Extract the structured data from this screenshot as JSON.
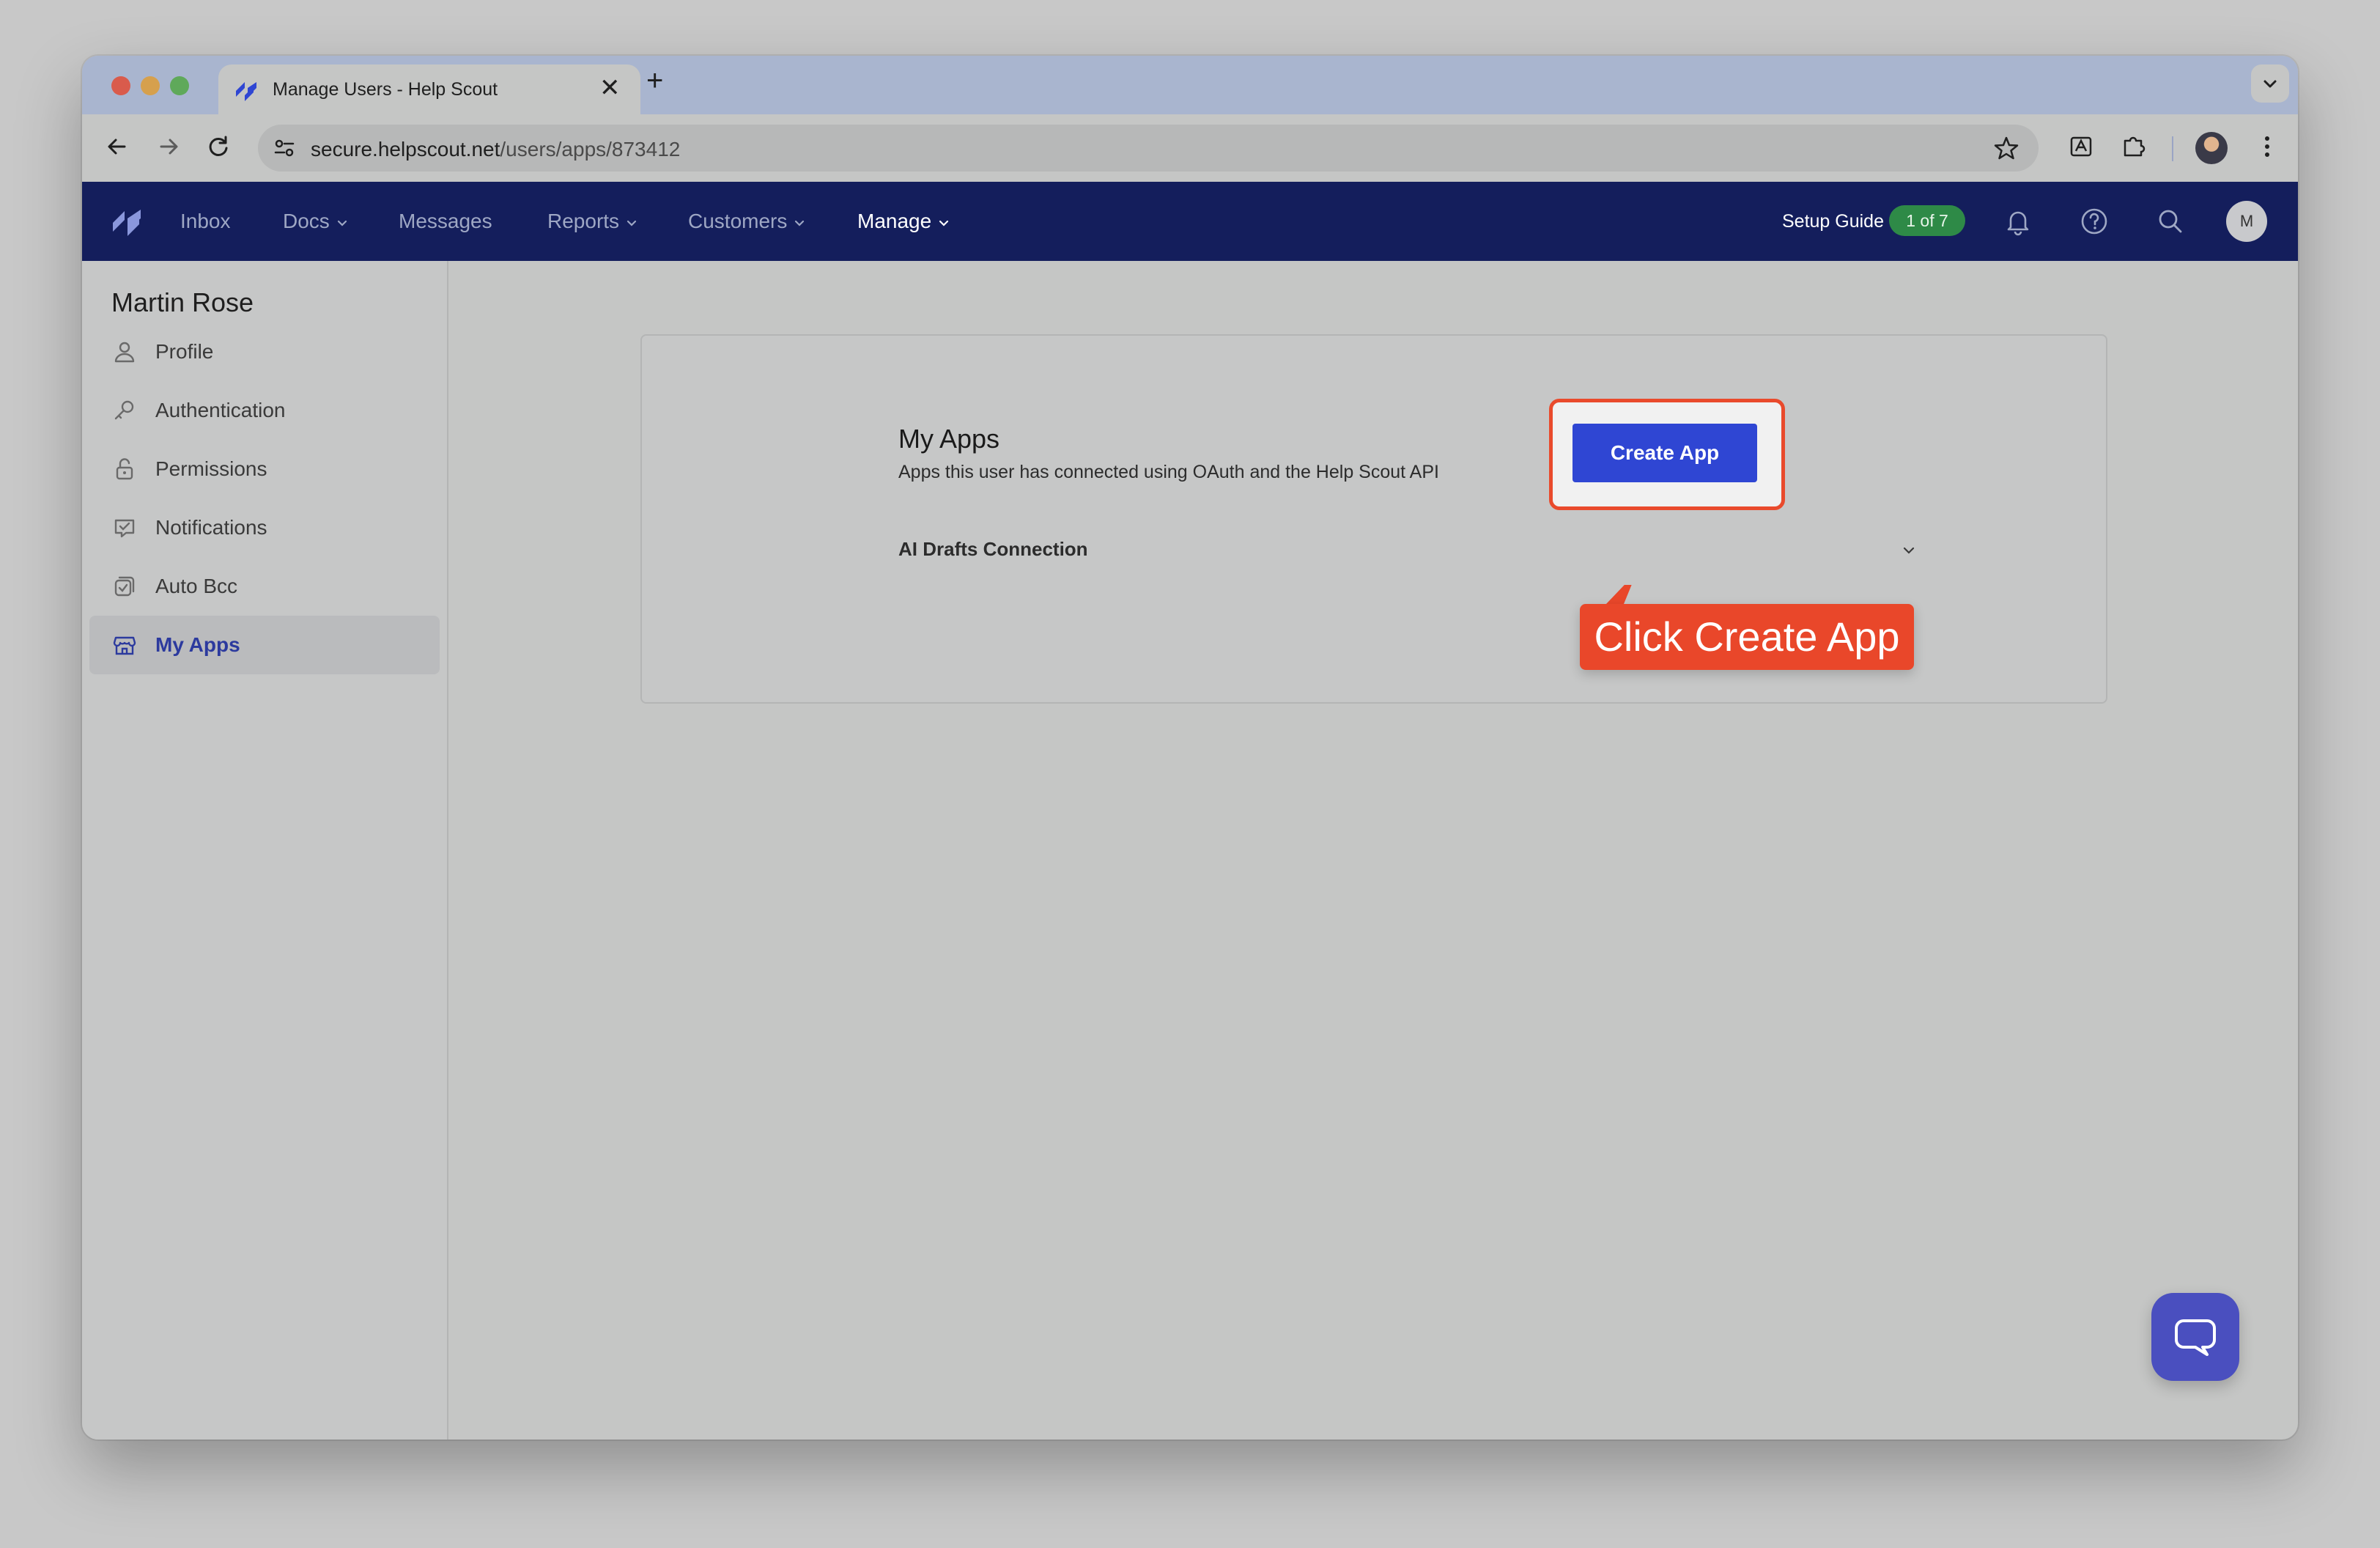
{
  "browser": {
    "tab_title": "Manage Users - Help Scout",
    "new_tab_symbol": "+",
    "close_symbol": "✕",
    "url_domain": "secure.helpscout.net",
    "url_path": "/users/apps/873412"
  },
  "header": {
    "nav": [
      {
        "label": "Inbox"
      },
      {
        "label": "Docs"
      },
      {
        "label": "Messages"
      },
      {
        "label": "Reports"
      },
      {
        "label": "Customers"
      },
      {
        "label": "Manage"
      }
    ],
    "setup_label": "Setup Guide",
    "setup_badge": "1 of 7",
    "avatar_initial": "M"
  },
  "sidebar": {
    "user_name": "Martin Rose",
    "items": [
      {
        "label": "Profile",
        "icon": "user-icon"
      },
      {
        "label": "Authentication",
        "icon": "key-icon"
      },
      {
        "label": "Permissions",
        "icon": "lock-icon"
      },
      {
        "label": "Notifications",
        "icon": "notification-icon"
      },
      {
        "label": "Auto Bcc",
        "icon": "auto-bcc-icon"
      },
      {
        "label": "My Apps",
        "icon": "store-icon"
      }
    ],
    "active_item": "My Apps"
  },
  "main": {
    "title": "My Apps",
    "subtitle": "Apps this user has connected using OAuth and the Help Scout API",
    "apps": [
      {
        "name": "AI Drafts Connection"
      }
    ],
    "create_button": "Create App"
  },
  "annotation": {
    "callout_text": "Click Create App",
    "color": "#e9472a"
  },
  "colors": {
    "appbar": "#141e5c",
    "primary_button": "#2f46d3",
    "setup_badge": "#2e8a47",
    "active_sidebar_text": "#2c3a9e"
  }
}
